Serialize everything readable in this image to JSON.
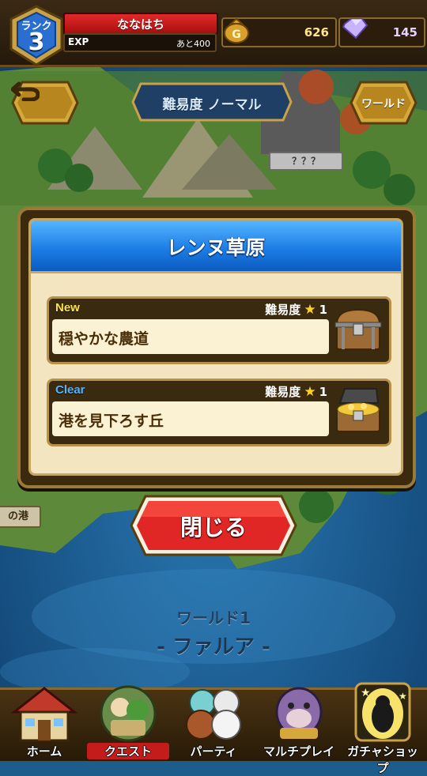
{
  "player": {
    "rank_label": "ランク",
    "rank": "3",
    "name": "ななはち",
    "exp_label": "EXP",
    "exp_remaining": "あと400",
    "coins": "626",
    "gems": "145"
  },
  "header": {
    "difficulty": "難易度 ノーマル",
    "world_button": "ワールド",
    "locked_area": "？？？"
  },
  "popup": {
    "title": "レンヌ草原",
    "stages": [
      {
        "status": "New",
        "difficulty_label": "難易度",
        "difficulty": "1",
        "name": "穏やかな農道",
        "chest": "closed"
      },
      {
        "status": "Clear",
        "difficulty_label": "難易度",
        "difficulty": "1",
        "name": "港を見下ろす丘",
        "chest": "open"
      }
    ],
    "close_button": "閉じる"
  },
  "map": {
    "port_label": "の港",
    "world_number": "ワールド1",
    "world_name": "- ファルア -"
  },
  "nav": {
    "items": [
      {
        "label": "ホーム",
        "icon": "house-icon",
        "active": false
      },
      {
        "label": "クエスト",
        "icon": "quest-icon",
        "active": true
      },
      {
        "label": "パーティ",
        "icon": "party-icon",
        "active": false
      },
      {
        "label": "マルチプレイ",
        "icon": "multiplayer-icon",
        "active": false
      },
      {
        "label": "ガチャショップ",
        "icon": "gacha-icon",
        "active": false
      }
    ]
  },
  "colors": {
    "accent_red": "#d81e1e",
    "popup_header_blue": "#1d7ee6",
    "gold_border": "#9a7a36",
    "sea_blue": "#1d5d8c"
  }
}
